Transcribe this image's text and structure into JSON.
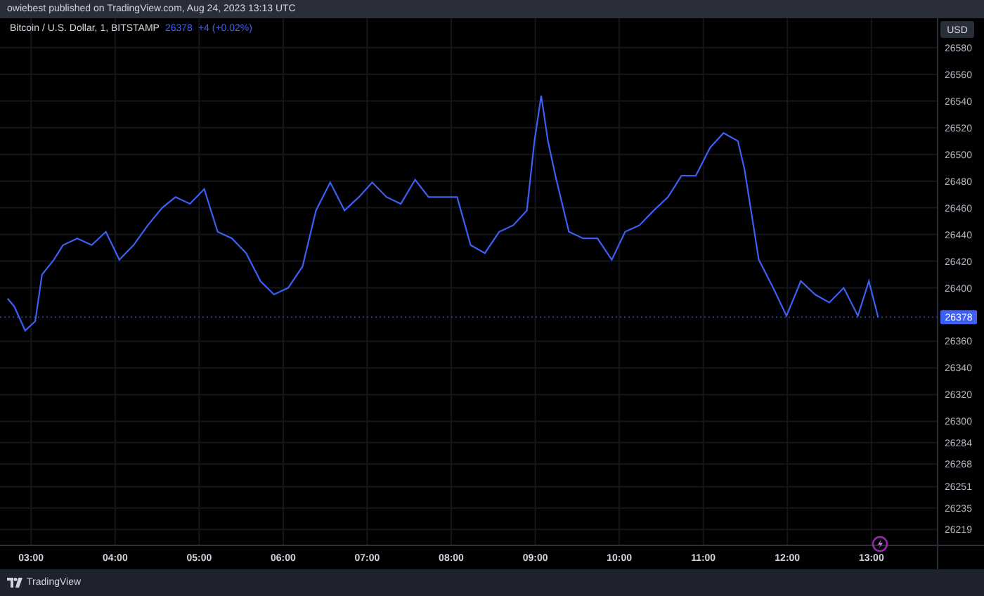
{
  "header": {
    "text": "owiebest published on TradingView.com, Aug 24, 2023 13:13 UTC"
  },
  "legend": {
    "price": "26378",
    "change": "+4 (+0.02%)"
  },
  "price_axis": {
    "currency": "USD"
  },
  "chart_data": {
    "type": "line",
    "x": [
      2.72,
      2.8,
      2.93,
      3.05,
      3.13,
      3.27,
      3.38,
      3.55,
      3.72,
      3.89,
      4.05,
      4.22,
      4.39,
      4.56,
      4.72,
      4.89,
      5.06,
      5.22,
      5.39,
      5.56,
      5.73,
      5.89,
      6.06,
      6.23,
      6.39,
      6.56,
      6.73,
      6.9,
      7.06,
      7.23,
      7.4,
      7.57,
      7.73,
      7.9,
      8.07,
      8.23,
      8.4,
      8.57,
      8.74,
      8.9,
      8.99,
      9.07,
      9.15,
      9.24,
      9.4,
      9.57,
      9.74,
      9.91,
      10.07,
      10.24,
      10.41,
      10.58,
      10.74,
      10.91,
      11.08,
      11.24,
      11.41,
      11.49,
      11.66,
      11.83,
      11.99,
      12.16,
      12.33,
      12.5,
      12.67,
      12.84,
      12.97,
      13.08
    ],
    "series": [
      {
        "name": "Bitcoin / U.S. Dollar, 1, BITSTAMP",
        "color": "#3d5ff5",
        "values": [
          26392,
          26386,
          26368,
          26375,
          26410,
          26421,
          26432,
          26437,
          26432,
          26442,
          26421,
          26432,
          26447,
          26460,
          26468,
          26463,
          26474,
          26442,
          26437,
          26426,
          26405,
          26395,
          26400,
          26416,
          26458,
          26479,
          26458,
          26468,
          26479,
          26468,
          26463,
          26481,
          26468,
          26468,
          26468,
          26432,
          26426,
          26442,
          26447,
          26458,
          26510,
          26544,
          26510,
          26484,
          26442,
          26437,
          26437,
          26421,
          26442,
          26447,
          26458,
          26468,
          26484,
          26484,
          26505,
          26516,
          26510,
          26489,
          26421,
          26400,
          26379,
          26405,
          26395,
          26389,
          26400,
          26379,
          26405,
          26378
        ]
      }
    ],
    "xlim": [
      2.63,
      14.34
    ],
    "ylim": [
      26207,
      26602
    ],
    "grid": true,
    "ref_lines": [
      {
        "axis": "y",
        "value": 26378,
        "label": "26378",
        "color": "#2a3a80"
      }
    ],
    "xticks": [
      {
        "value": 3,
        "label": "03:00"
      },
      {
        "value": 4,
        "label": "04:00"
      },
      {
        "value": 5,
        "label": "05:00"
      },
      {
        "value": 6,
        "label": "06:00"
      },
      {
        "value": 7,
        "label": "07:00"
      },
      {
        "value": 8,
        "label": "08:00"
      },
      {
        "value": 9,
        "label": "09:00"
      },
      {
        "value": 10,
        "label": "10:00"
      },
      {
        "value": 11,
        "label": "11:00"
      },
      {
        "value": 12,
        "label": "12:00"
      },
      {
        "value": 13,
        "label": "13:00"
      }
    ],
    "yticks": [
      26580,
      26560,
      26540,
      26520,
      26500,
      26480,
      26460,
      26440,
      26420,
      26400,
      26360,
      26340,
      26320,
      26300,
      26284,
      26268,
      26251,
      26235,
      26219
    ]
  },
  "footer": {
    "brand": "TradingView"
  }
}
